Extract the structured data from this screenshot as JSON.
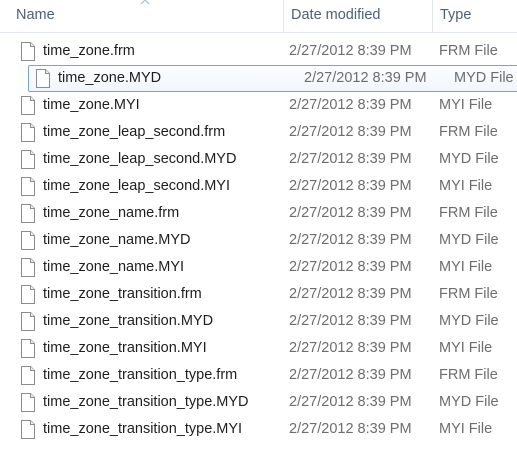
{
  "columns": {
    "name": "Name",
    "date_modified": "Date modified",
    "type": "Type"
  },
  "sort": {
    "column": "name",
    "direction": "ascending"
  },
  "accent": {
    "selection_border": "#7da2ce",
    "header_text": "#4c607a"
  },
  "files": [
    {
      "name": "time_zone.frm",
      "date": "2/27/2012 8:39 PM",
      "type": "FRM File",
      "selected": false
    },
    {
      "name": "time_zone.MYD",
      "date": "2/27/2012 8:39 PM",
      "type": "MYD File",
      "selected": true
    },
    {
      "name": "time_zone.MYI",
      "date": "2/27/2012 8:39 PM",
      "type": "MYI File",
      "selected": false
    },
    {
      "name": "time_zone_leap_second.frm",
      "date": "2/27/2012 8:39 PM",
      "type": "FRM File",
      "selected": false
    },
    {
      "name": "time_zone_leap_second.MYD",
      "date": "2/27/2012 8:39 PM",
      "type": "MYD File",
      "selected": false
    },
    {
      "name": "time_zone_leap_second.MYI",
      "date": "2/27/2012 8:39 PM",
      "type": "MYI File",
      "selected": false
    },
    {
      "name": "time_zone_name.frm",
      "date": "2/27/2012 8:39 PM",
      "type": "FRM File",
      "selected": false
    },
    {
      "name": "time_zone_name.MYD",
      "date": "2/27/2012 8:39 PM",
      "type": "MYD File",
      "selected": false
    },
    {
      "name": "time_zone_name.MYI",
      "date": "2/27/2012 8:39 PM",
      "type": "MYI File",
      "selected": false
    },
    {
      "name": "time_zone_transition.frm",
      "date": "2/27/2012 8:39 PM",
      "type": "FRM File",
      "selected": false
    },
    {
      "name": "time_zone_transition.MYD",
      "date": "2/27/2012 8:39 PM",
      "type": "MYD File",
      "selected": false
    },
    {
      "name": "time_zone_transition.MYI",
      "date": "2/27/2012 8:39 PM",
      "type": "MYI File",
      "selected": false
    },
    {
      "name": "time_zone_transition_type.frm",
      "date": "2/27/2012 8:39 PM",
      "type": "FRM File",
      "selected": false
    },
    {
      "name": "time_zone_transition_type.MYD",
      "date": "2/27/2012 8:39 PM",
      "type": "MYD File",
      "selected": false
    },
    {
      "name": "time_zone_transition_type.MYI",
      "date": "2/27/2012 8:39 PM",
      "type": "MYI File",
      "selected": false
    }
  ],
  "icons": {
    "file": "generic-file-icon",
    "sort": "sort-ascending-icon"
  }
}
